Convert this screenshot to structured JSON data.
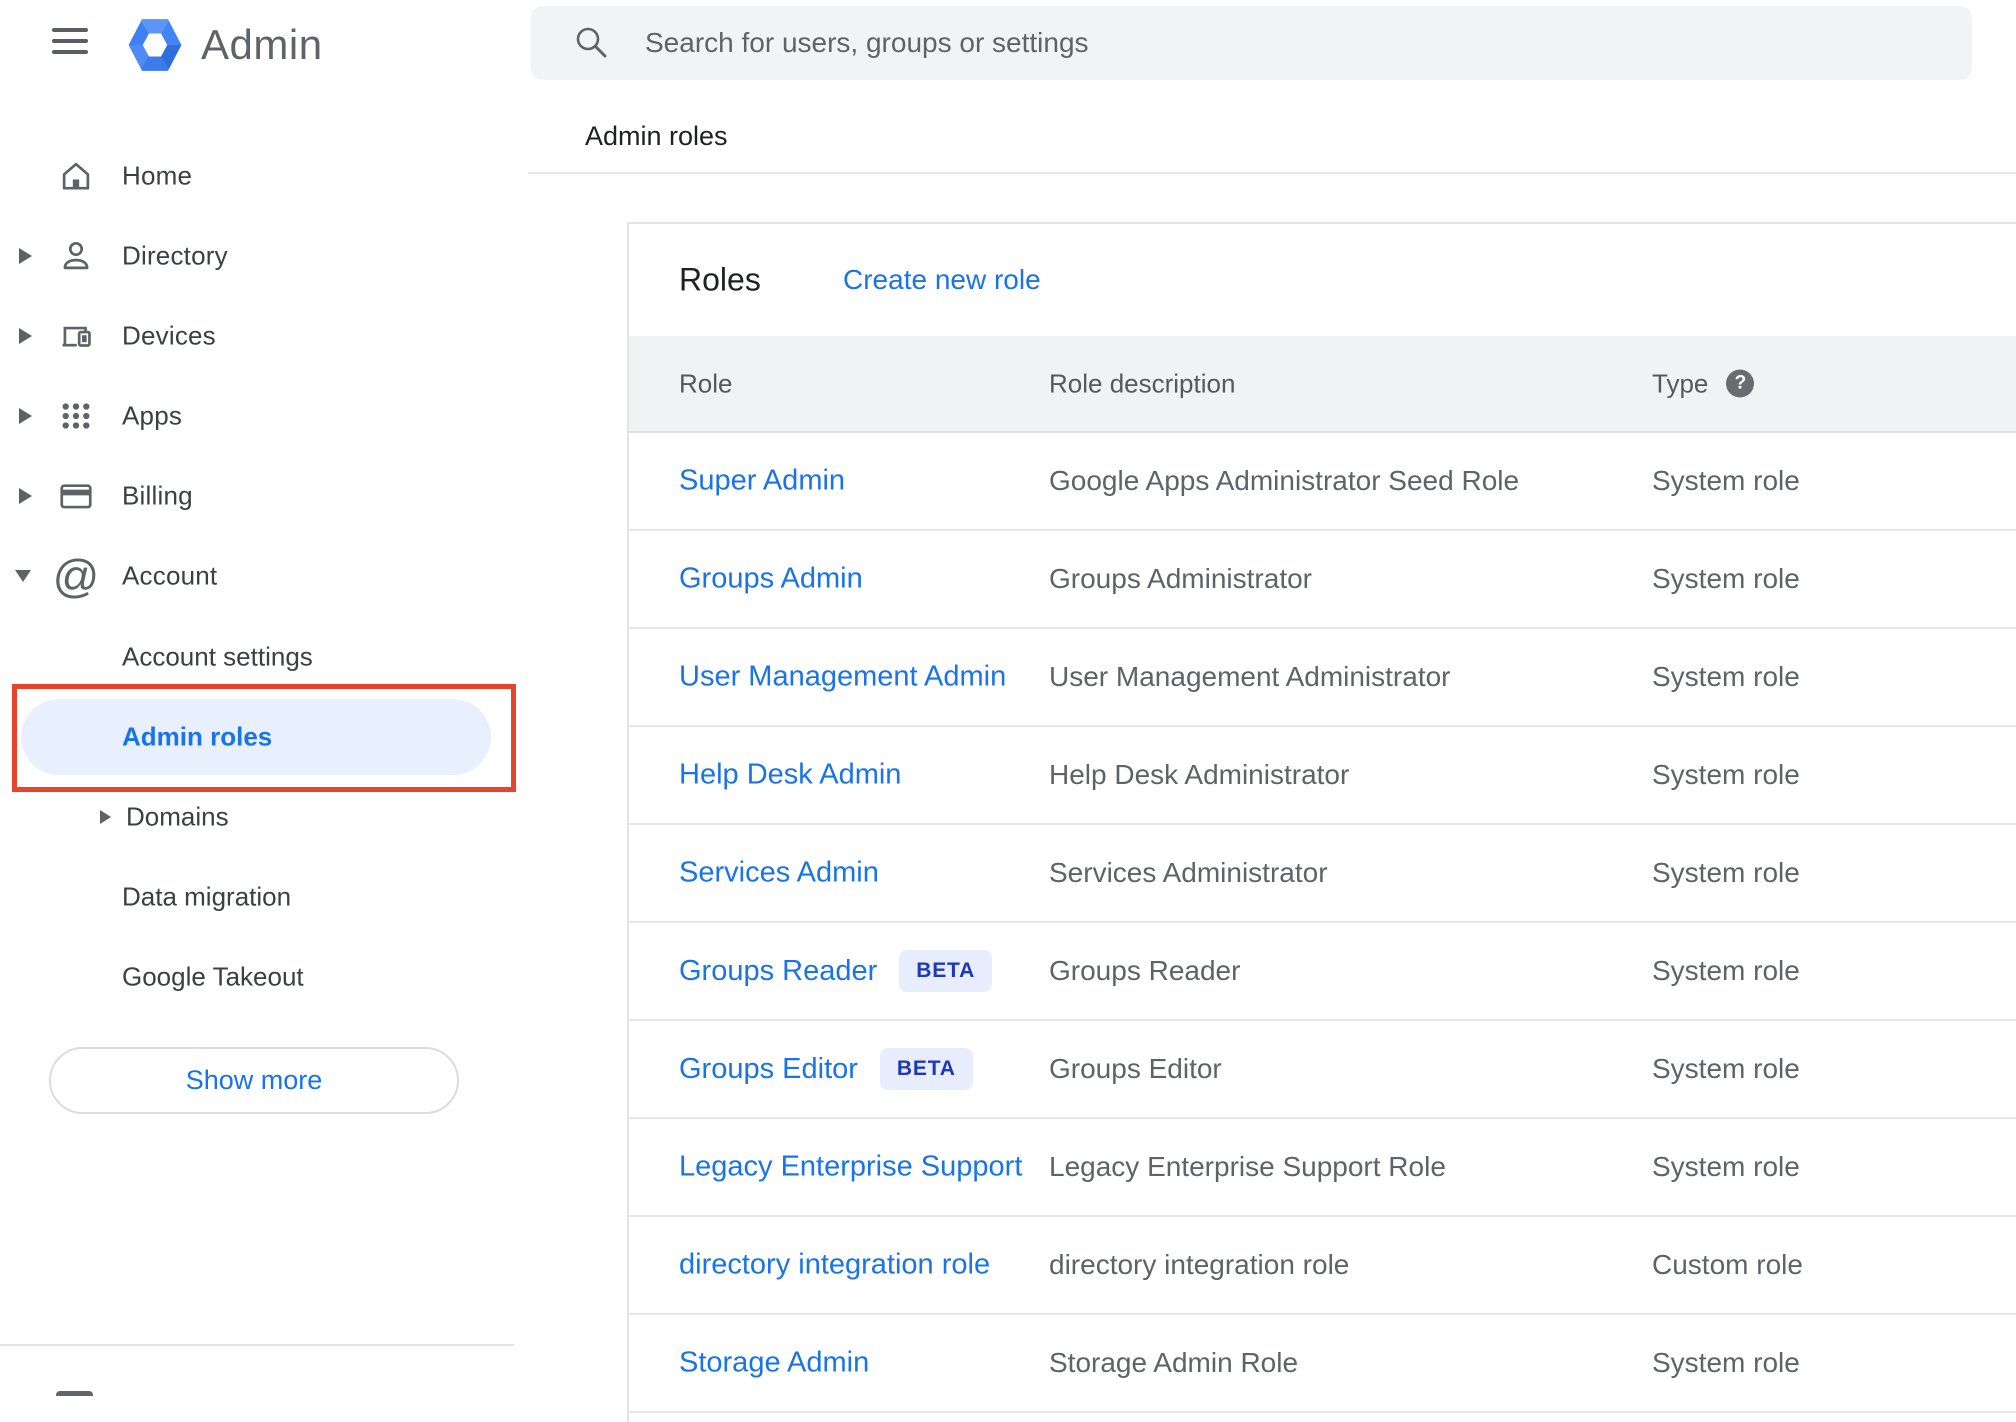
{
  "topbar": {
    "logo_text": "Admin",
    "search_placeholder": "Search for users, groups or settings"
  },
  "breadcrumb": "Admin roles",
  "sidebar": {
    "items": [
      {
        "label": "Home",
        "icon": "home-icon",
        "expandable": false
      },
      {
        "label": "Directory",
        "icon": "person-icon",
        "expandable": true,
        "expanded": false
      },
      {
        "label": "Devices",
        "icon": "devices-icon",
        "expandable": true,
        "expanded": false
      },
      {
        "label": "Apps",
        "icon": "apps-grid-icon",
        "expandable": true,
        "expanded": false
      },
      {
        "label": "Billing",
        "icon": "credit-card-icon",
        "expandable": true,
        "expanded": false
      },
      {
        "label": "Account",
        "icon": "at-sign-icon",
        "expandable": true,
        "expanded": true
      }
    ],
    "account_children": [
      {
        "label": "Account settings",
        "active": false
      },
      {
        "label": "Admin roles",
        "active": true,
        "annotated": true
      },
      {
        "label": "Domains",
        "active": false,
        "expandable": true
      },
      {
        "label": "Data migration",
        "active": false
      },
      {
        "label": "Google Takeout",
        "active": false
      }
    ],
    "show_more_label": "Show more"
  },
  "panel": {
    "title": "Roles",
    "create_link": "Create new role",
    "table": {
      "headers": {
        "role": "Role",
        "description": "Role description",
        "type": "Type",
        "help_glyph": "?"
      },
      "rows": [
        {
          "role": "Super Admin",
          "description": "Google Apps Administrator Seed Role",
          "type": "System role"
        },
        {
          "role": "Groups Admin",
          "description": "Groups Administrator",
          "type": "System role"
        },
        {
          "role": "User Management Admin",
          "description": "User Management Administrator",
          "type": "System role"
        },
        {
          "role": "Help Desk Admin",
          "description": "Help Desk Administrator",
          "type": "System role"
        },
        {
          "role": "Services Admin",
          "description": "Services Administrator",
          "type": "System role"
        },
        {
          "role": "Groups Reader",
          "badge": "BETA",
          "description": "Groups Reader",
          "type": "System role"
        },
        {
          "role": "Groups Editor",
          "badge": "BETA",
          "description": "Groups Editor",
          "type": "System role"
        },
        {
          "role": "Legacy Enterprise Support",
          "description": "Legacy Enterprise Support Role",
          "type": "System role"
        },
        {
          "role": "directory integration role",
          "description": "directory integration role",
          "type": "Custom role"
        },
        {
          "role": "Storage Admin",
          "description": "Storage Admin Role",
          "type": "System role"
        }
      ]
    }
  },
  "colors": {
    "accent_blue": "#1a73e8",
    "annotation_red": "#e8442a",
    "active_item_bg": "#e8f0fe",
    "beta_badge_bg": "#e7edfc",
    "beta_badge_text": "#1d39b5",
    "table_header_bg": "#f1f2f3",
    "icon_gray": "#5f6368",
    "text_dark": "#202124",
    "text_gray": "#5f6368",
    "logo_blue": "#4285f4"
  }
}
